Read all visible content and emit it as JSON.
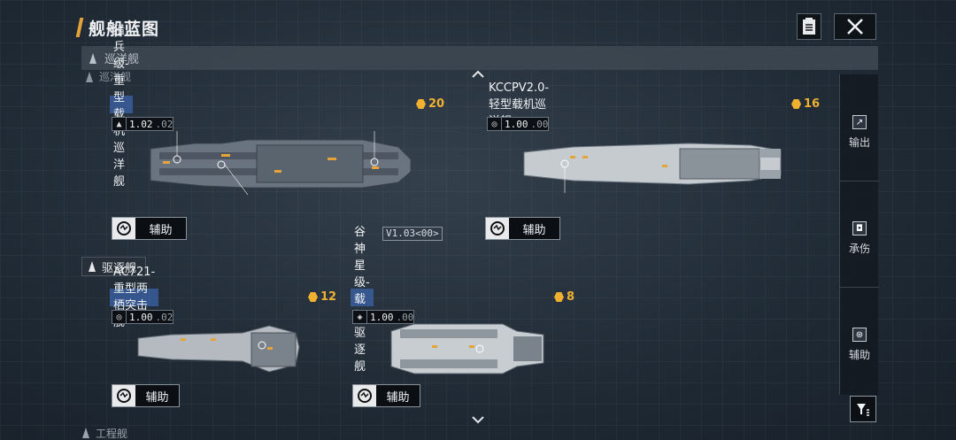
{
  "header": {
    "title": "舰船蓝图"
  },
  "category_bar": {
    "label": "巡洋舰",
    "ghost_label": "巡洋舰"
  },
  "sections": [
    {
      "label": "驱逐舰"
    }
  ],
  "ships": [
    {
      "name": "猎兵级-重型载机巡洋舰",
      "version_main": "1.02",
      "version_sub": ".02",
      "version_icon": "rocket-icon",
      "cost": "20",
      "role": "辅助",
      "blueprint_tag": "V1.03<00>"
    },
    {
      "name": "KCCPV2.0-轻型载机巡洋舰",
      "version_main": "1.00",
      "version_sub": ".00",
      "version_icon": "globe-icon",
      "cost": "16",
      "role": "辅助"
    },
    {
      "name": "AC721-重型两栖突击舰",
      "version_main": "1.00",
      "version_sub": ".02",
      "version_icon": "globe-icon",
      "cost": "12",
      "role": "辅助"
    },
    {
      "name": "谷神星级-载机驱逐舰",
      "version_main": "1.00",
      "version_sub": ".00",
      "version_icon": "shield-icon",
      "cost": "8",
      "role": "辅助"
    }
  ],
  "side_panel": [
    {
      "label": "输出",
      "icon": "arrow-icon"
    },
    {
      "label": "承伤",
      "icon": "shield-icon"
    },
    {
      "label": "辅助",
      "icon": "support-icon"
    }
  ],
  "bottom_partial": "工程舰",
  "colors": {
    "accent": "#e4a43a",
    "cost": "#f0b030",
    "highlight": "#3c64aa"
  }
}
